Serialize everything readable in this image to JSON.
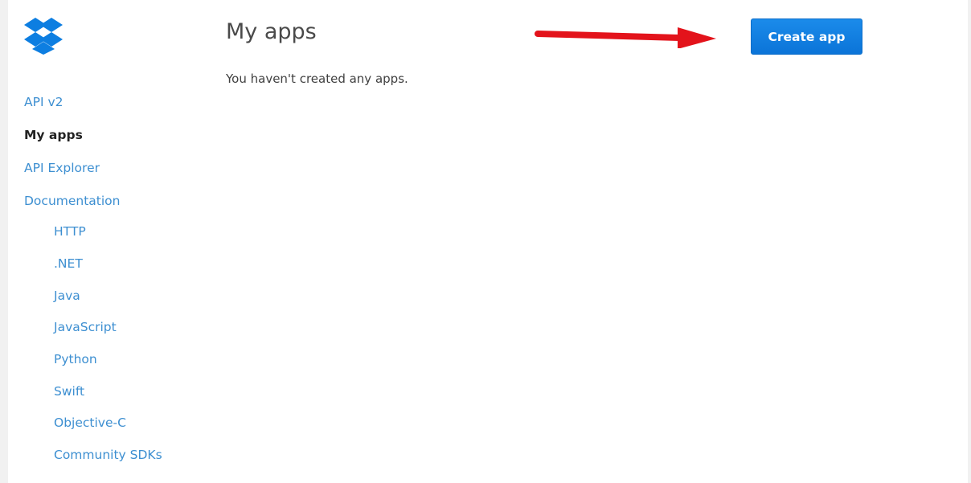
{
  "brand": {
    "logo": "dropbox-logo-icon",
    "logo_color": "#0d7ee1"
  },
  "sidebar": {
    "items": [
      {
        "label": "API v2",
        "active": false
      },
      {
        "label": "My apps",
        "active": true
      },
      {
        "label": "API Explorer",
        "active": false
      },
      {
        "label": "Documentation",
        "active": false
      }
    ],
    "documentation_items": [
      {
        "label": "HTTP"
      },
      {
        "label": ".NET"
      },
      {
        "label": "Java"
      },
      {
        "label": "JavaScript"
      },
      {
        "label": "Python"
      },
      {
        "label": "Swift"
      },
      {
        "label": "Objective-C"
      },
      {
        "label": "Community SDKs"
      }
    ]
  },
  "main": {
    "title": "My apps",
    "empty_message": "You haven't created any apps.",
    "create_button_label": "Create app"
  },
  "annotation": {
    "arrow_icon": "red-arrow-icon",
    "arrow_color": "#e3131b"
  },
  "colors": {
    "link": "#3d8fd1",
    "active": "#222222",
    "button": "#0b74d8"
  }
}
